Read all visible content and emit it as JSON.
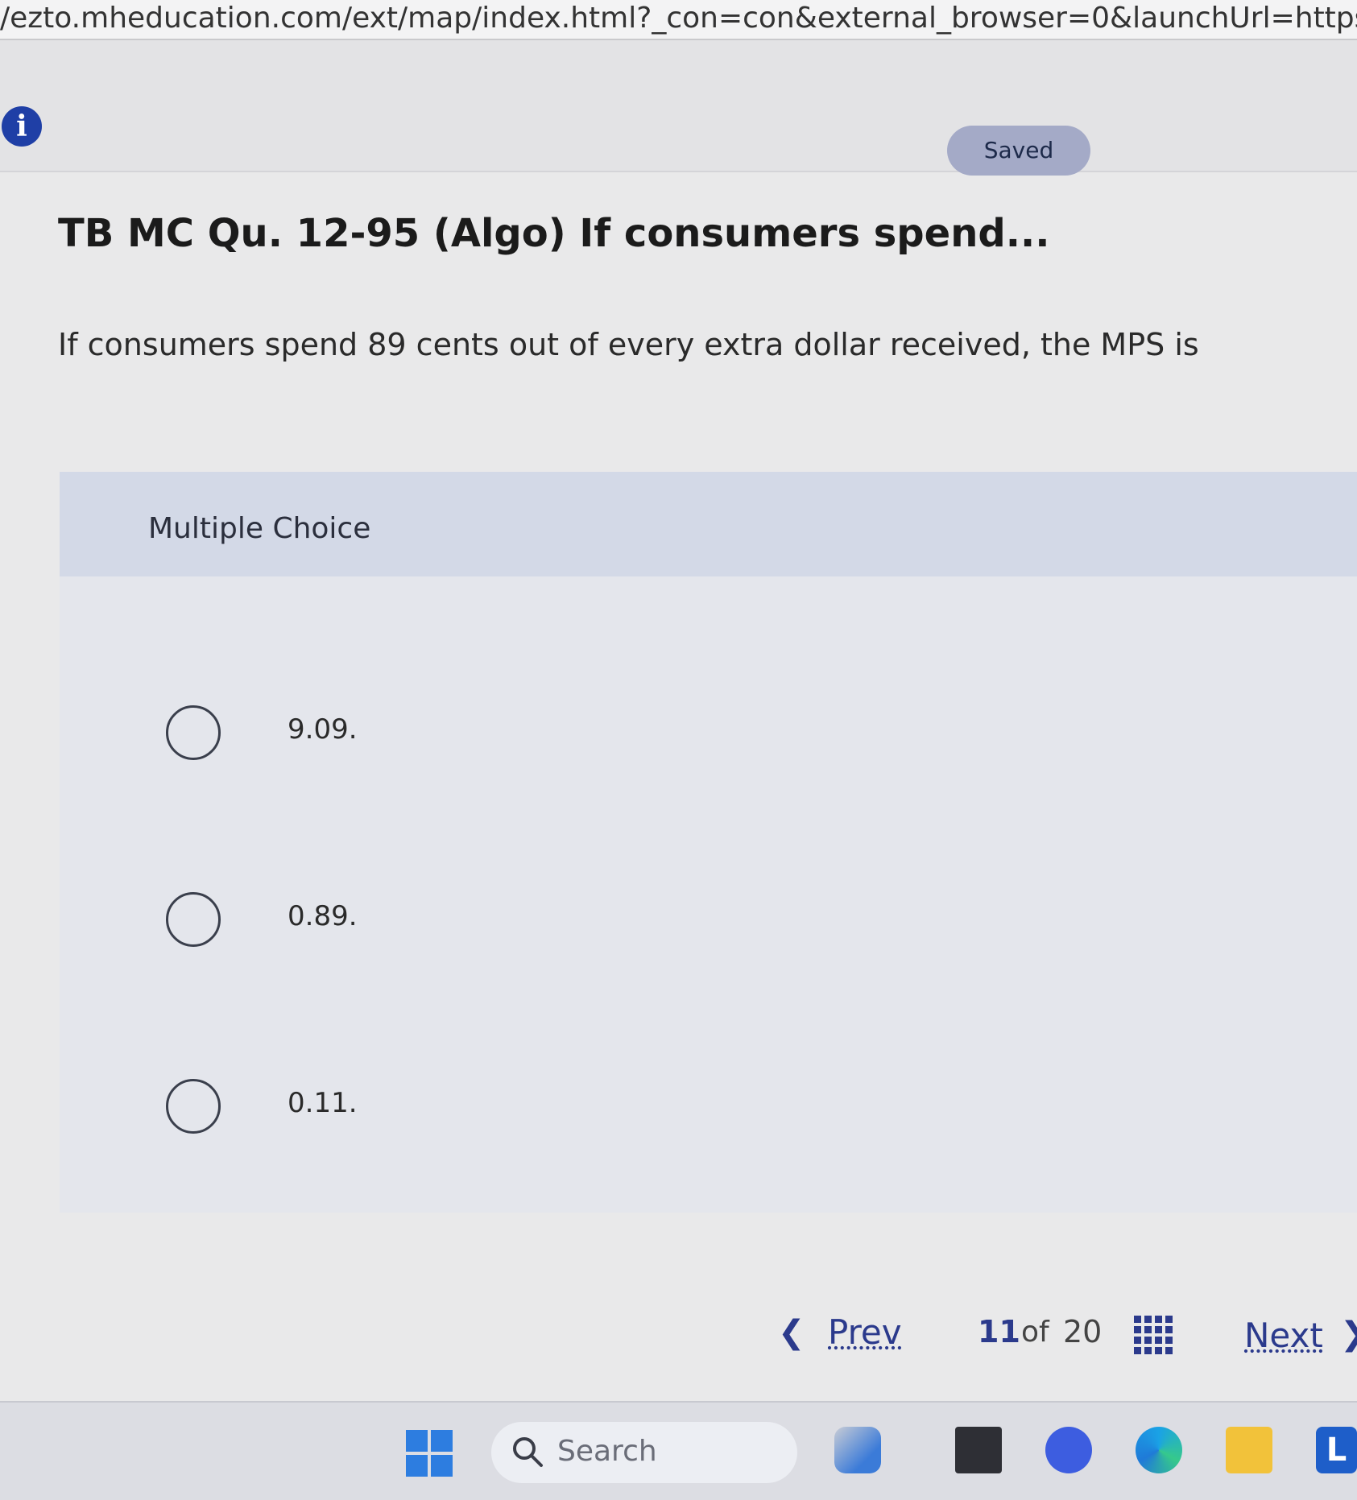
{
  "browser": {
    "url": "/ezto.mheducation.com/ext/map/index.html?_con=con&external_browser=0&launchUrl=https%253A%2"
  },
  "toolbar": {
    "info_icon": "info-icon",
    "saved_label": "Saved"
  },
  "question": {
    "title": "TB MC Qu. 12-95 (Algo) If consumers spend...",
    "text": "If consumers spend 89 cents out of every extra dollar received, the MPS is"
  },
  "multiple_choice": {
    "label": "Multiple Choice",
    "options": [
      {
        "text": "9.09."
      },
      {
        "text": "0.89."
      },
      {
        "text": "0.11."
      }
    ]
  },
  "pagination": {
    "prev_label": "Prev",
    "current": "11",
    "of_label": "of",
    "total": "20",
    "next_label": "Next"
  },
  "taskbar": {
    "search_placeholder": "Search",
    "l_app_label": "L"
  },
  "colors": {
    "accent": "#2b3a8c",
    "saved_pill": "#a4aac7",
    "mc_header": "#d3d9e7",
    "info_icon": "#1f3fa6"
  }
}
